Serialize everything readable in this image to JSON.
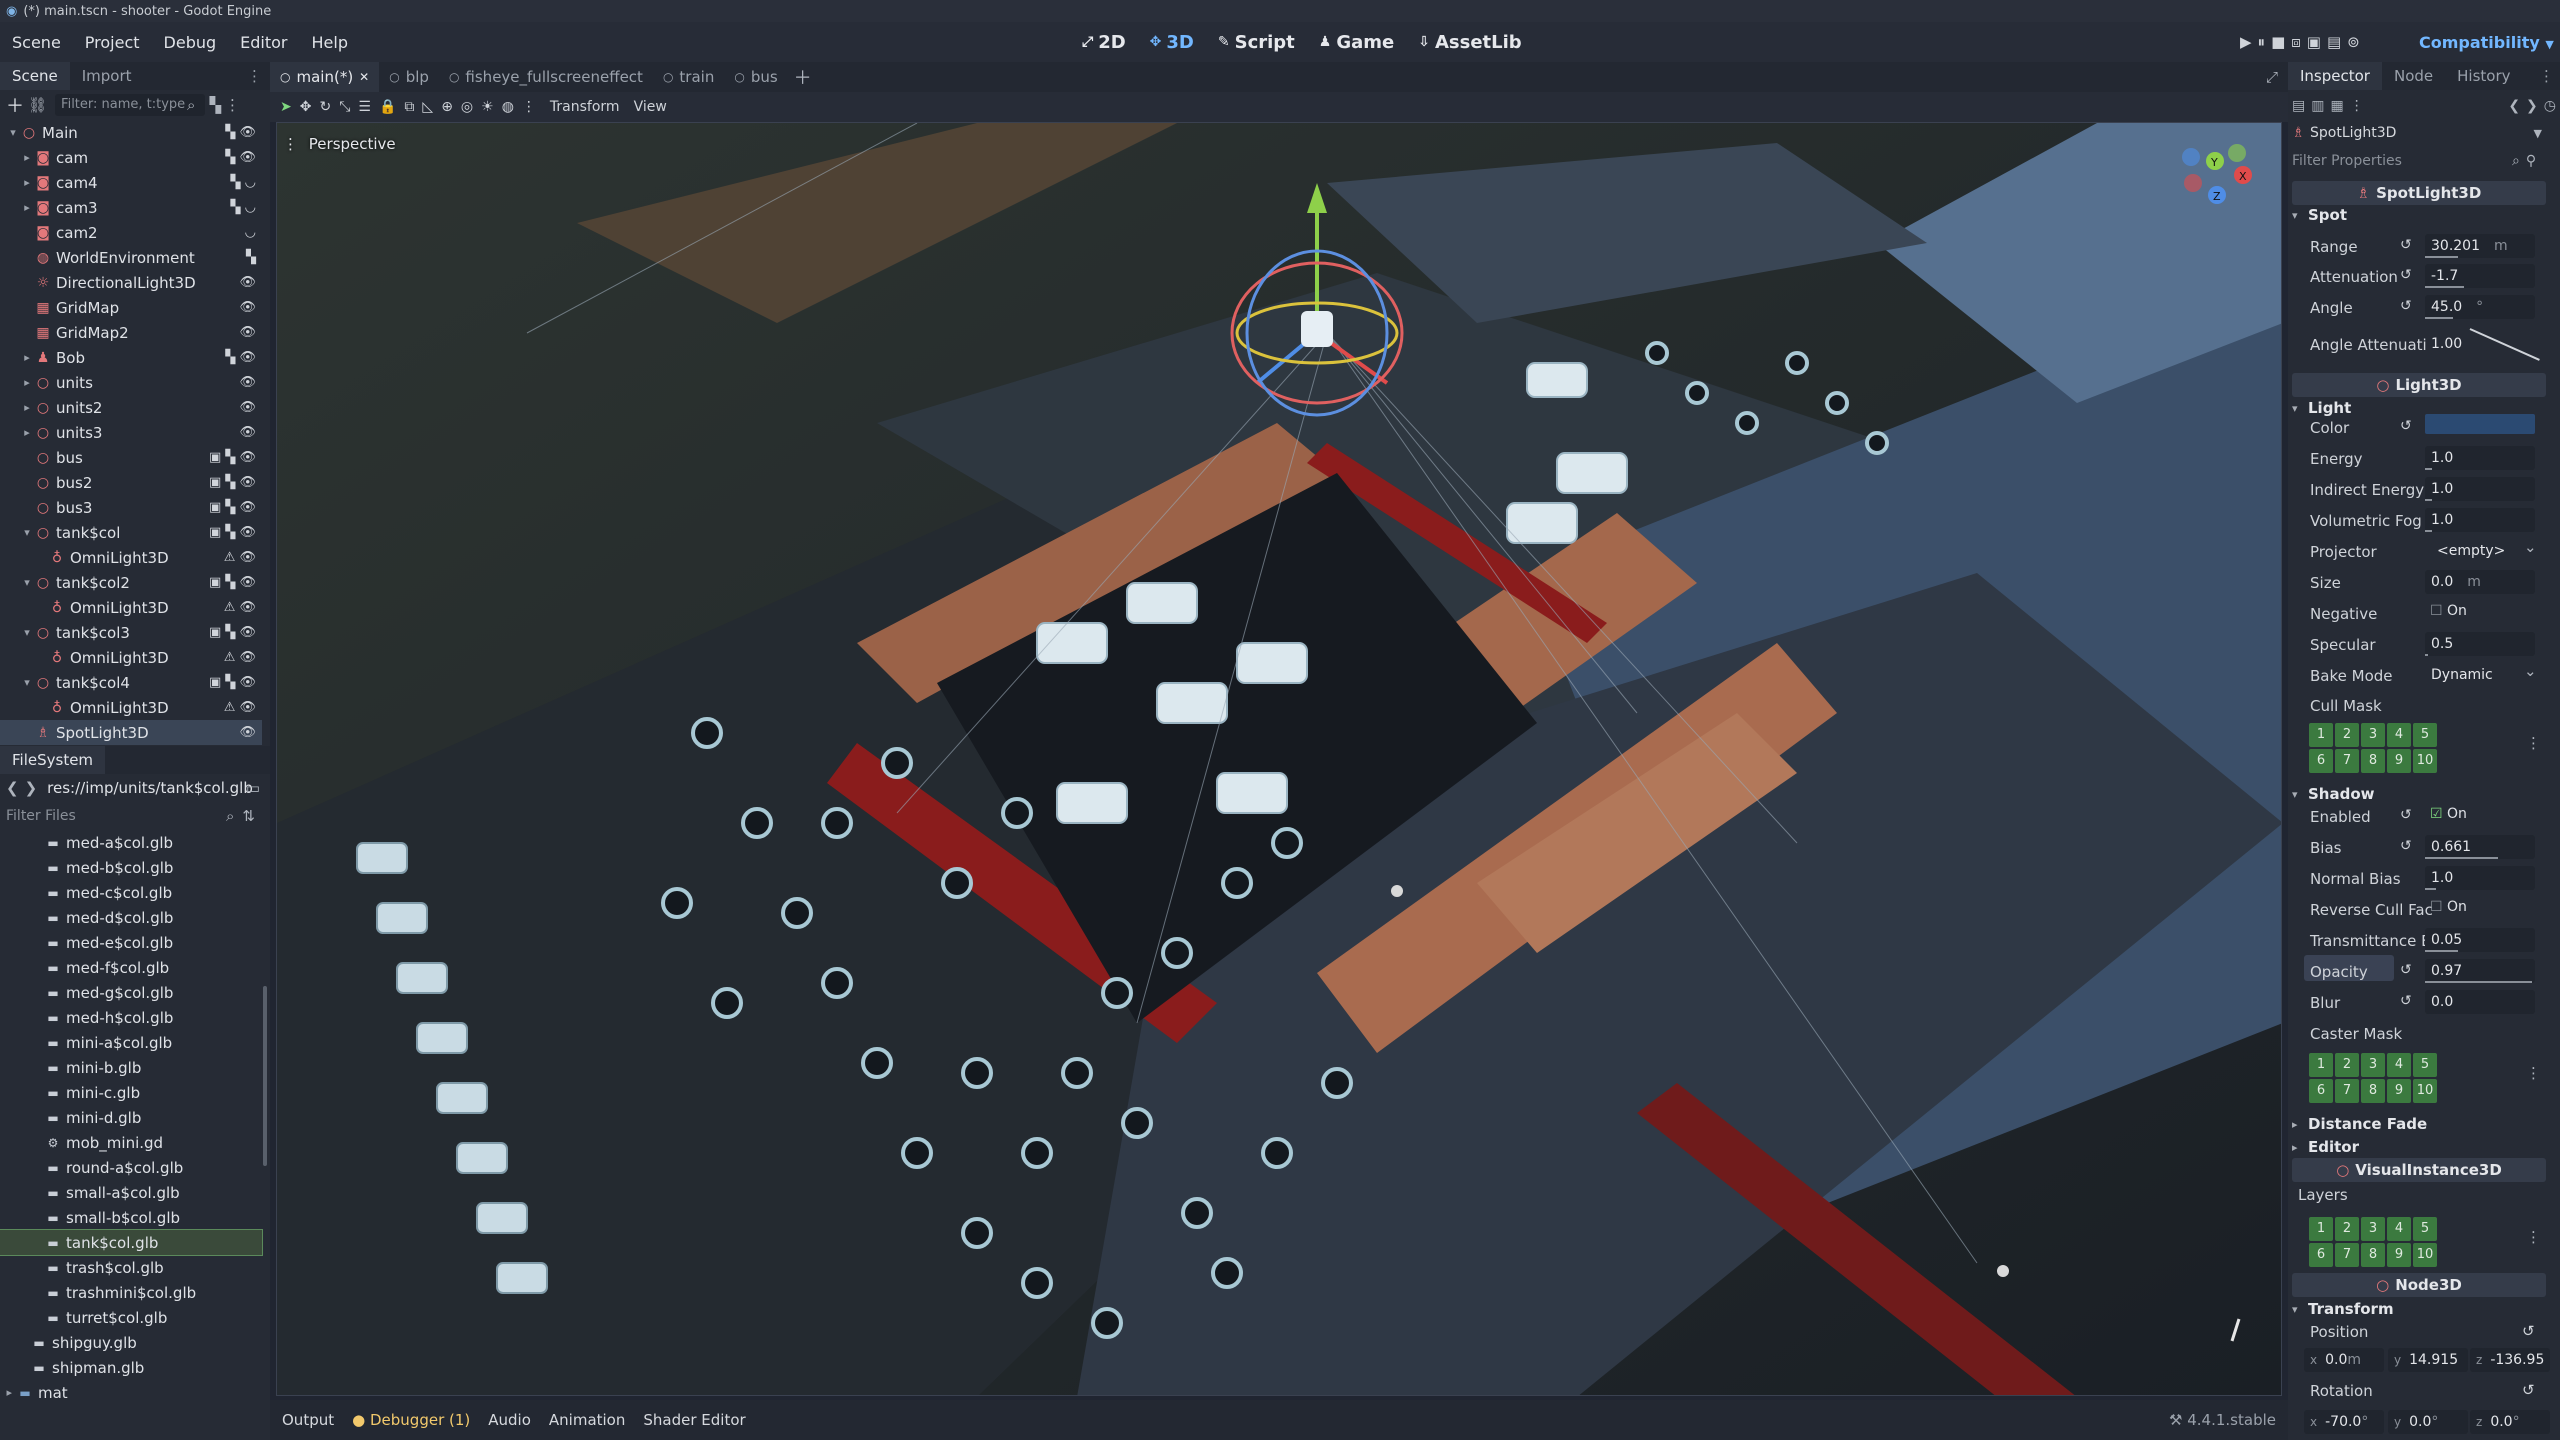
{
  "window_title": "(*) main.tscn - shooter - Godot Engine",
  "menu": [
    "Scene",
    "Project",
    "Debug",
    "Editor",
    "Help"
  ],
  "workspaces": [
    {
      "label": "2D",
      "icon": "2d-icon"
    },
    {
      "label": "3D",
      "icon": "3d-icon"
    },
    {
      "label": "Script",
      "icon": "script-icon"
    },
    {
      "label": "Game",
      "icon": "game-icon"
    },
    {
      "label": "AssetLib",
      "icon": "assetlib-icon"
    }
  ],
  "renderer": "Compatibility",
  "scene_dock": {
    "tabs": [
      "Scene",
      "Import"
    ],
    "filter_placeholder": "Filter: name, t:type",
    "nodes": [
      {
        "name": "Main",
        "depth": 0,
        "icon": "node3d-icon",
        "color": "#e3787b",
        "arrow": "▾",
        "tools": "▚ 👁"
      },
      {
        "name": "cam",
        "depth": 1,
        "icon": "camera-icon",
        "color": "#e3787b",
        "arrow": "▸",
        "tools": "▚ 👁"
      },
      {
        "name": "cam4",
        "depth": 1,
        "icon": "camera-icon",
        "color": "#e3787b",
        "arrow": "▸",
        "tools": "▚ ◡"
      },
      {
        "name": "cam3",
        "depth": 1,
        "icon": "camera-icon",
        "color": "#e3787b",
        "arrow": "▸",
        "tools": "▚ ◡"
      },
      {
        "name": "cam2",
        "depth": 1,
        "icon": "camera-icon",
        "color": "#e3787b",
        "arrow": "",
        "tools": "◡"
      },
      {
        "name": "WorldEnvironment",
        "depth": 1,
        "icon": "world-env-icon",
        "color": "#e3787b",
        "arrow": "",
        "tools": "▚"
      },
      {
        "name": "DirectionalLight3D",
        "depth": 1,
        "icon": "directional-light-icon",
        "color": "#e3787b",
        "arrow": "",
        "tools": "👁"
      },
      {
        "name": "GridMap",
        "depth": 1,
        "icon": "gridmap-icon",
        "color": "#e3787b",
        "arrow": "",
        "tools": "👁"
      },
      {
        "name": "GridMap2",
        "depth": 1,
        "icon": "gridmap-icon",
        "color": "#e3787b",
        "arrow": "",
        "tools": "👁"
      },
      {
        "name": "Bob",
        "depth": 1,
        "icon": "character-icon",
        "color": "#e3787b",
        "arrow": "▸",
        "tools": "▚ 👁"
      },
      {
        "name": "units",
        "depth": 1,
        "icon": "node3d-icon",
        "color": "#e3787b",
        "arrow": "▸",
        "tools": "👁"
      },
      {
        "name": "units2",
        "depth": 1,
        "icon": "node3d-icon",
        "color": "#e3787b",
        "arrow": "▸",
        "tools": "👁"
      },
      {
        "name": "units3",
        "depth": 1,
        "icon": "node3d-icon",
        "color": "#e3787b",
        "arrow": "▸",
        "tools": "👁"
      },
      {
        "name": "bus",
        "depth": 1,
        "icon": "node3d-icon",
        "color": "#e3787b",
        "arrow": "",
        "tools": "▣ ▚ 👁"
      },
      {
        "name": "bus2",
        "depth": 1,
        "icon": "node3d-icon",
        "color": "#e3787b",
        "arrow": "",
        "tools": "▣ ▚ 👁"
      },
      {
        "name": "bus3",
        "depth": 1,
        "icon": "node3d-icon",
        "color": "#e3787b",
        "arrow": "",
        "tools": "▣ ▚ 👁"
      },
      {
        "name": "tank$col",
        "depth": 1,
        "icon": "node3d-icon",
        "color": "#e3787b",
        "arrow": "▾",
        "tools": "▣ ▚ 👁"
      },
      {
        "name": "OmniLight3D",
        "depth": 2,
        "icon": "omni-light-icon",
        "color": "#e3787b",
        "arrow": "",
        "tools": "⚠ 👁"
      },
      {
        "name": "tank$col2",
        "depth": 1,
        "icon": "node3d-icon",
        "color": "#e3787b",
        "arrow": "▾",
        "tools": "▣ ▚ 👁"
      },
      {
        "name": "OmniLight3D",
        "depth": 2,
        "icon": "omni-light-icon",
        "color": "#e3787b",
        "arrow": "",
        "tools": "⚠ 👁"
      },
      {
        "name": "tank$col3",
        "depth": 1,
        "icon": "node3d-icon",
        "color": "#e3787b",
        "arrow": "▾",
        "tools": "▣ ▚ 👁"
      },
      {
        "name": "OmniLight3D",
        "depth": 2,
        "icon": "omni-light-icon",
        "color": "#e3787b",
        "arrow": "",
        "tools": "⚠ 👁"
      },
      {
        "name": "tank$col4",
        "depth": 1,
        "icon": "node3d-icon",
        "color": "#e3787b",
        "arrow": "▾",
        "tools": "▣ ▚ 👁"
      },
      {
        "name": "OmniLight3D",
        "depth": 2,
        "icon": "omni-light-icon",
        "color": "#e3787b",
        "arrow": "",
        "tools": "⚠ 👁"
      },
      {
        "name": "SpotLight3D",
        "depth": 1,
        "icon": "spot-light-icon",
        "color": "#e3787b",
        "arrow": "",
        "tools": "👁",
        "selected": true
      }
    ]
  },
  "filesystem_dock": {
    "tab": "FileSystem",
    "path": "res://imp/units/tank$col.glb",
    "filter_placeholder": "Filter Files",
    "files": [
      {
        "name": "med-a$col.glb",
        "depth": 2,
        "icon": "scene-file-icon"
      },
      {
        "name": "med-b$col.glb",
        "depth": 2,
        "icon": "scene-file-icon"
      },
      {
        "name": "med-c$col.glb",
        "depth": 2,
        "icon": "scene-file-icon"
      },
      {
        "name": "med-d$col.glb",
        "depth": 2,
        "icon": "scene-file-icon"
      },
      {
        "name": "med-e$col.glb",
        "depth": 2,
        "icon": "scene-file-icon"
      },
      {
        "name": "med-f$col.glb",
        "depth": 2,
        "icon": "scene-file-icon"
      },
      {
        "name": "med-g$col.glb",
        "depth": 2,
        "icon": "scene-file-icon"
      },
      {
        "name": "med-h$col.glb",
        "depth": 2,
        "icon": "scene-file-icon"
      },
      {
        "name": "mini-a$col.glb",
        "depth": 2,
        "icon": "scene-file-icon"
      },
      {
        "name": "mini-b.glb",
        "depth": 2,
        "icon": "scene-file-icon"
      },
      {
        "name": "mini-c.glb",
        "depth": 2,
        "icon": "scene-file-icon"
      },
      {
        "name": "mini-d.glb",
        "depth": 2,
        "icon": "scene-file-icon"
      },
      {
        "name": "mob_mini.gd",
        "depth": 2,
        "icon": "gear-icon"
      },
      {
        "name": "round-a$col.glb",
        "depth": 2,
        "icon": "scene-file-icon"
      },
      {
        "name": "small-a$col.glb",
        "depth": 2,
        "icon": "scene-file-icon"
      },
      {
        "name": "small-b$col.glb",
        "depth": 2,
        "icon": "scene-file-icon"
      },
      {
        "name": "tank$col.glb",
        "depth": 2,
        "icon": "scene-file-icon",
        "selected": true
      },
      {
        "name": "trash$col.glb",
        "depth": 2,
        "icon": "scene-file-icon"
      },
      {
        "name": "trashmini$col.glb",
        "depth": 2,
        "icon": "scene-file-icon"
      },
      {
        "name": "turret$col.glb",
        "depth": 2,
        "icon": "scene-file-icon"
      },
      {
        "name": "shipguy.glb",
        "depth": 1,
        "icon": "scene-file-icon"
      },
      {
        "name": "shipman.glb",
        "depth": 1,
        "icon": "scene-file-icon"
      },
      {
        "name": "mat",
        "depth": 0,
        "icon": "folder-icon",
        "folder": true
      }
    ]
  },
  "scene_tabs": [
    "main(*)",
    "blp",
    "fisheye_fullscreeneffect",
    "train",
    "bus"
  ],
  "viewport": {
    "toolbar_menus": [
      "Transform",
      "View"
    ],
    "label": "Perspective",
    "gizmo_axes": [
      "Y",
      "X",
      "Z"
    ]
  },
  "bottom_panel": {
    "tabs": [
      "Output",
      "Debugger (1)",
      "Audio",
      "Animation",
      "Shader Editor"
    ],
    "version": "4.4.1.stable"
  },
  "inspector": {
    "tabs": [
      "Inspector",
      "Node",
      "History"
    ],
    "node_type": "SpotLight3D",
    "filter_placeholder": "Filter Properties",
    "class_header": "SpotLight3D",
    "spot": {
      "title": "Spot",
      "range_label": "Range",
      "range": "30.201",
      "range_unit": "m",
      "attenuation_label": "Attenuation",
      "attenuation": "-1.7",
      "angle_label": "Angle",
      "angle": "45.0",
      "angle_unit": "°",
      "angle_att_label": "Angle Attenuati",
      "angle_att": "1.00"
    },
    "light3d_header": "Light3D",
    "light": {
      "title": "Light",
      "color_label": "Color",
      "color": "#2b4a72",
      "energy_label": "Energy",
      "energy": "1.0",
      "indirect_label": "Indirect Energy",
      "indirect": "1.0",
      "fog_label": "Volumetric Fog",
      "fog": "1.0",
      "projector_label": "Projector",
      "projector": "<empty>",
      "size_label": "Size",
      "size": "0.0",
      "size_unit": "m",
      "negative_label": "Negative",
      "negative": "On",
      "specular_label": "Specular",
      "specular": "0.5",
      "bake_label": "Bake Mode",
      "bake": "Dynamic",
      "cull_label": "Cull Mask"
    },
    "shadow": {
      "title": "Shadow",
      "enabled_label": "Enabled",
      "enabled": "On",
      "bias_label": "Bias",
      "bias": "0.661",
      "normal_bias_label": "Normal Bias",
      "normal_bias": "1.0",
      "reverse_label": "Reverse Cull Fac",
      "reverse": "On",
      "transmittance_label": "Transmittance B",
      "transmittance": "0.05",
      "opacity_label": "Opacity",
      "opacity": "0.97",
      "blur_label": "Blur",
      "blur": "0.0",
      "caster_label": "Caster Mask"
    },
    "distance_fade": "Distance Fade",
    "editor": "Editor",
    "visual_header": "VisualInstance3D",
    "layers_label": "Layers",
    "node3d_header": "Node3D",
    "transform": {
      "title": "Transform",
      "position_label": "Position",
      "pos_x": "0.0",
      "pos_x_unit": "m",
      "pos_y": "14.915",
      "pos_z": "-136.95",
      "rotation_label": "Rotation",
      "rot_x": "-70.0",
      "rot_y": "0.0",
      "rot_z": "0.0",
      "rot_unit": "°"
    },
    "mask_rows": [
      [
        "1",
        "2",
        "3",
        "4",
        "5"
      ],
      [
        "6",
        "7",
        "8",
        "9",
        "10"
      ]
    ]
  }
}
